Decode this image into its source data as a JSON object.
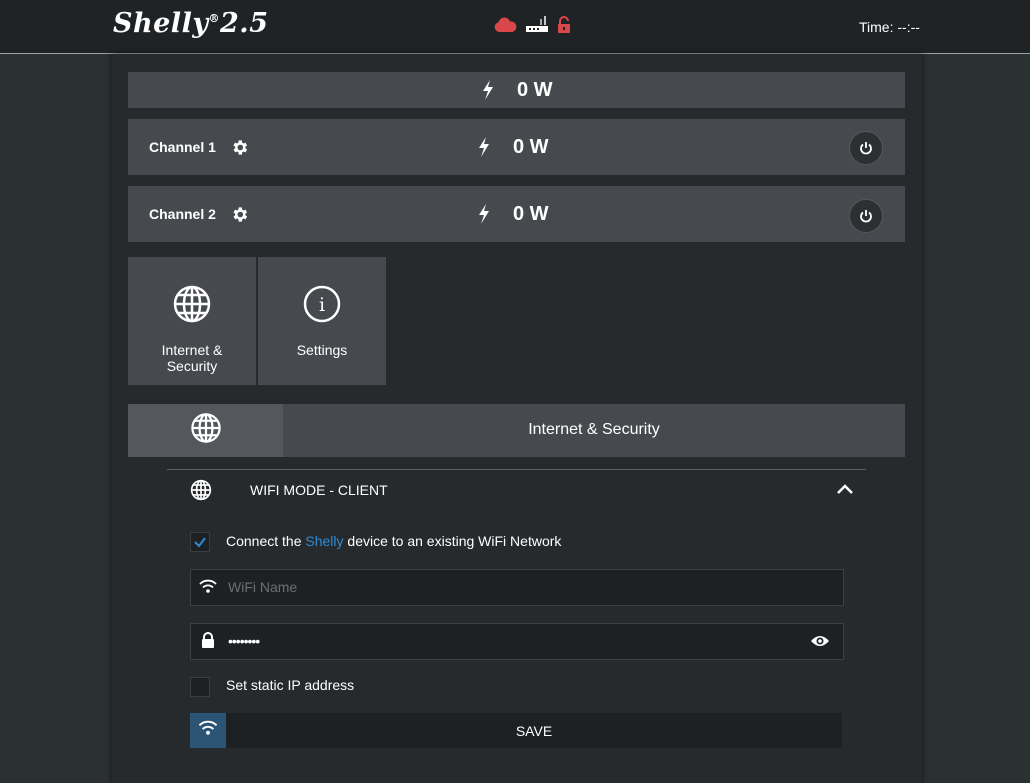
{
  "header": {
    "logo_text": "Shelly",
    "logo_sup": "®",
    "logo_model": "2.5",
    "time_label": "Time:",
    "time_value": "--:--",
    "status_icons": [
      "cloud-icon",
      "router-icon",
      "unlocked-icon"
    ],
    "status_color": "#d9474b"
  },
  "total": {
    "power": "0 W"
  },
  "channels": [
    {
      "label": "Channel 1",
      "power": "0 W"
    },
    {
      "label": "Channel 2",
      "power": "0 W"
    }
  ],
  "tiles": [
    {
      "label_line1": "Internet &",
      "label_line2": "Security",
      "icon": "globe-icon"
    },
    {
      "label_line1": "Settings",
      "label_line2": "",
      "icon": "info-icon"
    }
  ],
  "section": {
    "title": "Internet & Security",
    "icon": "globe-icon"
  },
  "wifi_mode": {
    "label": "WIFI MODE - CLIENT"
  },
  "connect": {
    "checked": true,
    "text_before": "Connect the",
    "brand": "Shelly",
    "text_after": "device to an existing WiFi Network"
  },
  "wifi_name": {
    "placeholder": "WiFi Name",
    "value": ""
  },
  "wifi_password": {
    "value": "••••••••"
  },
  "static_ip": {
    "checked": false,
    "label": "Set static IP address"
  },
  "save": {
    "label": "SAVE"
  },
  "colors": {
    "accent": "#2e8bd6",
    "save_icon_bg": "#2c5474",
    "bar_bg": "#464a4e"
  }
}
